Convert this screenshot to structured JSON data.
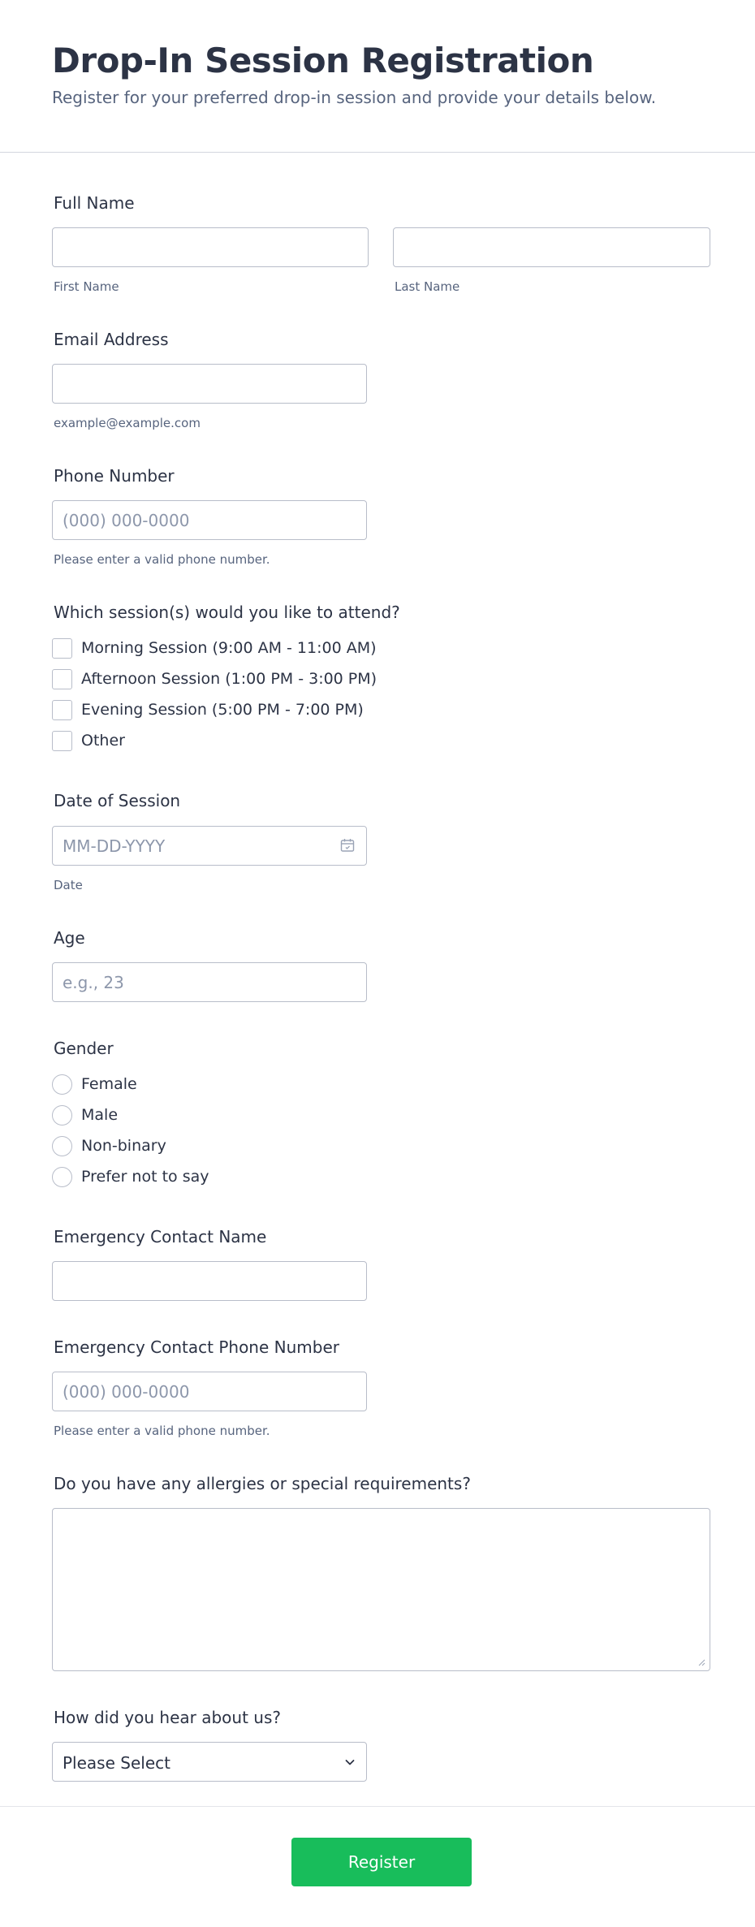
{
  "form": {
    "title": "Drop-In Session Registration",
    "subtitle": "Register for your preferred drop-in session and provide your details below."
  },
  "full_name": {
    "label": "Full Name",
    "first_sublabel": "First Name",
    "last_sublabel": "Last Name",
    "first_value": "",
    "last_value": ""
  },
  "email": {
    "label": "Email Address",
    "value": "",
    "sublabel": "example@example.com"
  },
  "phone": {
    "label": "Phone Number",
    "placeholder": "(000) 000-0000",
    "sublabel": "Please enter a valid phone number."
  },
  "sessions": {
    "label": "Which session(s) would you like to attend?",
    "options": [
      "Morning Session (9:00 AM - 11:00 AM)",
      "Afternoon Session (1:00 PM - 3:00 PM)",
      "Evening Session (5:00 PM - 7:00 PM)",
      "Other"
    ]
  },
  "date": {
    "label": "Date of Session",
    "placeholder": "MM-DD-YYYY",
    "sublabel": "Date",
    "icon": "calendar-icon"
  },
  "age": {
    "label": "Age",
    "placeholder": "e.g., 23"
  },
  "gender": {
    "label": "Gender",
    "options": [
      "Female",
      "Male",
      "Non-binary",
      "Prefer not to say"
    ]
  },
  "emergency_name": {
    "label": "Emergency Contact Name",
    "value": ""
  },
  "emergency_phone": {
    "label": "Emergency Contact Phone Number",
    "placeholder": "(000) 000-0000",
    "sublabel": "Please enter a valid phone number."
  },
  "allergies": {
    "label": "Do you have any allergies or special requirements?",
    "value": ""
  },
  "referral": {
    "label": "How did you hear about us?",
    "selected": "Please Select",
    "icon": "chevron-down-icon"
  },
  "submit": {
    "label": "Register"
  },
  "colors": {
    "accent": "#18bd5b",
    "text": "#2c3345",
    "muted": "#57647e",
    "border": "#b8bdc9"
  }
}
